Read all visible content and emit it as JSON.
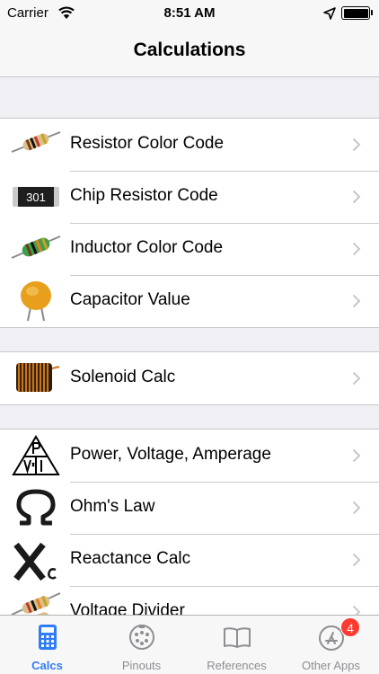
{
  "status_bar": {
    "carrier": "Carrier",
    "time": "8:51 AM",
    "wifi_icon": "wifi-icon",
    "location_icon": "location-arrow-icon",
    "battery_level": 1.0
  },
  "nav": {
    "title": "Calculations"
  },
  "sections": [
    {
      "rows": [
        {
          "label": "Resistor Color Code",
          "icon": "resistor-icon"
        },
        {
          "label": "Chip Resistor Code",
          "icon": "chip-resistor-icon",
          "icon_text": "301"
        },
        {
          "label": "Inductor Color Code",
          "icon": "inductor-icon"
        },
        {
          "label": "Capacitor Value",
          "icon": "capacitor-icon"
        }
      ]
    },
    {
      "rows": [
        {
          "label": "Solenoid Calc",
          "icon": "solenoid-icon"
        }
      ]
    },
    {
      "rows": [
        {
          "label": "Power, Voltage, Amperage",
          "icon": "pvi-triangle-icon"
        },
        {
          "label": "Ohm's Law",
          "icon": "omega-icon"
        },
        {
          "label": "Reactance Calc",
          "icon": "reactance-icon"
        },
        {
          "label": "Voltage Divider",
          "icon": "voltage-divider-icon"
        }
      ]
    }
  ],
  "tabbar": {
    "tabs": [
      {
        "label": "Calcs",
        "icon": "calculator-icon",
        "active": true
      },
      {
        "label": "Pinouts",
        "icon": "connector-icon",
        "active": false
      },
      {
        "label": "References",
        "icon": "book-icon",
        "active": false
      },
      {
        "label": "Other Apps",
        "icon": "app-store-icon",
        "active": false,
        "badge": "4"
      }
    ]
  },
  "colors": {
    "accent": "#2f7cf6",
    "badge": "#ff3b30",
    "background": "#efeff4",
    "separator": "#c8c7cc"
  }
}
